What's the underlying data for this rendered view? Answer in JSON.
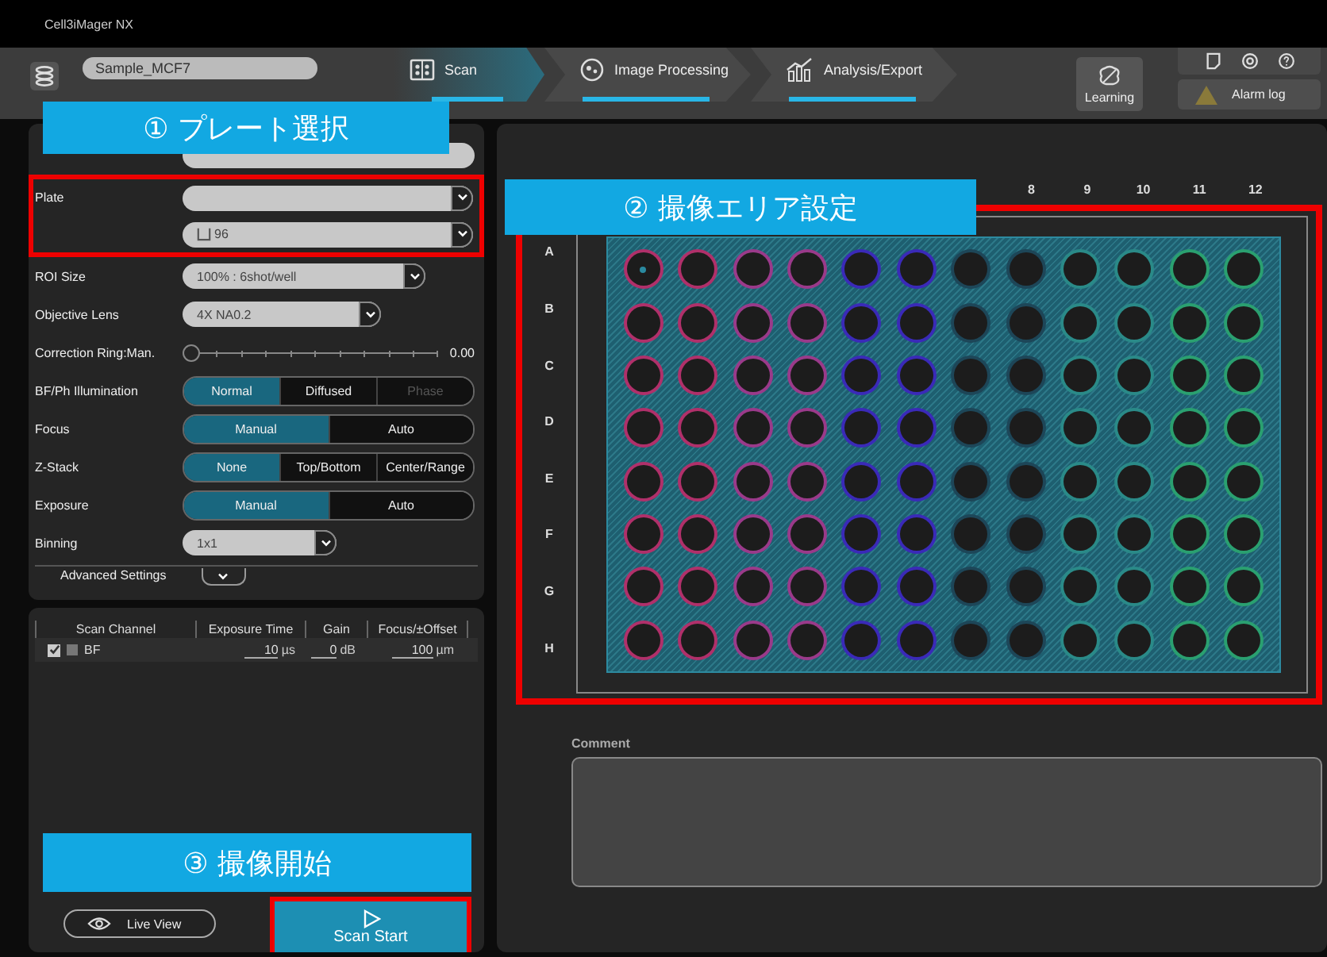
{
  "app_title": "Cell3iMager NX",
  "header": {
    "sample_name": "Sample_MCF7",
    "learning_label": "Learning",
    "alarm_label": "Alarm log",
    "steps": [
      {
        "label": "Scan",
        "selected": true
      },
      {
        "label": "Image Processing",
        "selected": false
      },
      {
        "label": "Analysis/Export",
        "selected": false
      }
    ]
  },
  "settings": [
    {
      "kind": "plate",
      "label": "Plate",
      "value": "96"
    },
    {
      "kind": "dropdown",
      "label": "ROI Size",
      "value": "100% : 6shot/well"
    },
    {
      "kind": "dropdown",
      "label": "Objective Lens",
      "value": "4X NA0.2"
    },
    {
      "kind": "slider",
      "label": "Correction Ring:Man.",
      "level": 0,
      "reading": "0.00"
    },
    {
      "kind": "segmented",
      "label": "BF/Ph Illumination",
      "options": [
        {
          "label": "Normal",
          "selected": true,
          "disabled": false
        },
        {
          "label": "Diffused",
          "selected": false,
          "disabled": false
        },
        {
          "label": "Phase",
          "selected": false,
          "disabled": true
        }
      ]
    },
    {
      "kind": "segmented",
      "label": "Focus",
      "options": [
        {
          "label": "Manual",
          "selected": true,
          "disabled": false
        },
        {
          "label": "Auto",
          "selected": false,
          "disabled": false
        }
      ]
    },
    {
      "kind": "segmented",
      "label": "Z-Stack",
      "options": [
        {
          "label": "None",
          "selected": true,
          "disabled": false
        },
        {
          "label": "Top/Bottom",
          "selected": false,
          "disabled": false
        },
        {
          "label": "Center/Range",
          "selected": false,
          "disabled": false
        }
      ]
    },
    {
      "kind": "segmented",
      "label": "Exposure",
      "options": [
        {
          "label": "Manual",
          "selected": true,
          "disabled": false
        },
        {
          "label": "Auto",
          "selected": false,
          "disabled": false
        }
      ]
    },
    {
      "kind": "dropdown",
      "label": "Binning",
      "value": "1x1"
    }
  ],
  "advanced_label": "Advanced Settings",
  "channel_table": {
    "columns": [
      "Scan Channel",
      "Exposure Time",
      "Gain",
      "Focus/±Offset"
    ],
    "rows": [
      {
        "checked": true,
        "name": "BF",
        "exposure": "10",
        "exposure_unit": "µs",
        "gain": "0",
        "gain_unit": "dB",
        "focus": "100",
        "focus_unit": "µm"
      }
    ]
  },
  "live_view_label": "Live View",
  "scan_start_label": "Scan Start",
  "plate": {
    "column_labels": [
      "8",
      "9",
      "10",
      "11",
      "12"
    ],
    "columns": [
      {
        "color": "#b0306a"
      },
      {
        "color": "#b0306a"
      },
      {
        "color": "#9a3a8a"
      },
      {
        "color": "#9a3a8a"
      },
      {
        "color": "#3a2ab8"
      },
      {
        "color": "#3a2ab8"
      },
      {
        "color": "#1d4658"
      },
      {
        "color": "#1d4658"
      },
      {
        "color": "#2a8a88"
      },
      {
        "color": "#2a8a88"
      },
      {
        "color": "#2aa070"
      },
      {
        "color": "#2aa070"
      }
    ],
    "rows": [
      {
        "label": "A",
        "marked": [
          true,
          false,
          false,
          false,
          false,
          false,
          false,
          false,
          false,
          false,
          false,
          false
        ]
      },
      {
        "label": "B",
        "marked": [
          false,
          false,
          false,
          false,
          false,
          false,
          false,
          false,
          false,
          false,
          false,
          false
        ]
      },
      {
        "label": "C",
        "marked": [
          false,
          false,
          false,
          false,
          false,
          false,
          false,
          false,
          false,
          false,
          false,
          false
        ]
      },
      {
        "label": "D",
        "marked": [
          false,
          false,
          false,
          false,
          false,
          false,
          false,
          false,
          false,
          false,
          false,
          false
        ]
      },
      {
        "label": "E",
        "marked": [
          false,
          false,
          false,
          false,
          false,
          false,
          false,
          false,
          false,
          false,
          false,
          false
        ]
      },
      {
        "label": "F",
        "marked": [
          false,
          false,
          false,
          false,
          false,
          false,
          false,
          false,
          false,
          false,
          false,
          false
        ]
      },
      {
        "label": "G",
        "marked": [
          false,
          false,
          false,
          false,
          false,
          false,
          false,
          false,
          false,
          false,
          false,
          false
        ]
      },
      {
        "label": "H",
        "marked": [
          false,
          false,
          false,
          false,
          false,
          false,
          false,
          false,
          false,
          false,
          false,
          false
        ]
      }
    ]
  },
  "comment_label": "Comment",
  "callouts": [
    {
      "text": "① プレート選択"
    },
    {
      "text": "② 撮像エリア設定"
    },
    {
      "text": "③ 撮像開始"
    }
  ]
}
